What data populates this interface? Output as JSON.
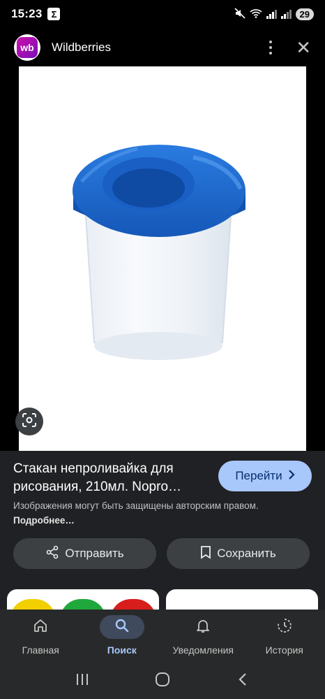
{
  "status_bar": {
    "time": "15:23",
    "sigma": "Σ",
    "battery": "29"
  },
  "header": {
    "site_name": "Wildberries",
    "logo_text": "wb"
  },
  "result": {
    "title": "Стакан непроливайка для рисования, 210мл. Nopro…",
    "visit_label": "Перейти",
    "copyright_text": "Изображения могут быть защищены авторским правом.",
    "more_link": "Подробнее…"
  },
  "actions": {
    "share_label": "Отправить",
    "save_label": "Сохранить"
  },
  "nav": {
    "items": [
      {
        "label": "Главная",
        "icon": "home-icon"
      },
      {
        "label": "Поиск",
        "icon": "search-icon"
      },
      {
        "label": "Уведомления",
        "icon": "bell-icon"
      },
      {
        "label": "История",
        "icon": "history-icon"
      }
    ],
    "active": "Поиск"
  },
  "colors": {
    "accent": "#a8c7fa",
    "product_cap": "#1f6fd1",
    "background": "#202124"
  }
}
